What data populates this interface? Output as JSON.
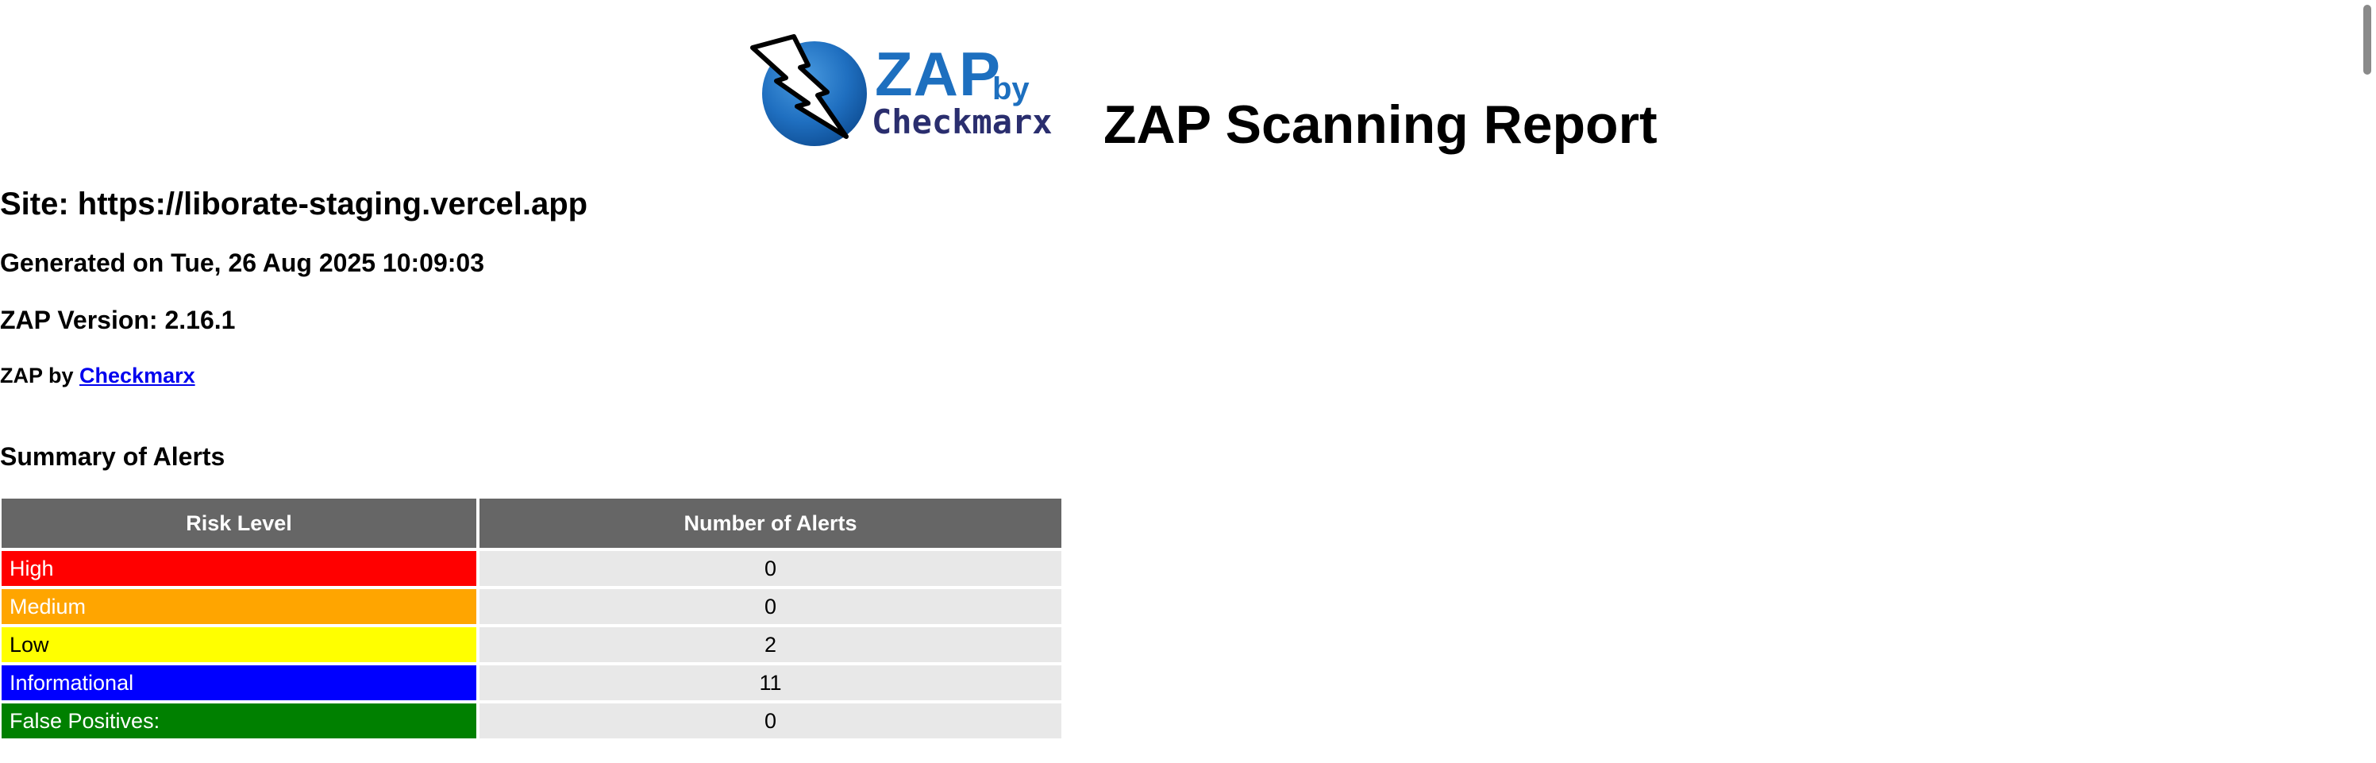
{
  "logo": {
    "icon": "lightning-bolt-icon",
    "word": "ZAP",
    "by": "by",
    "brand": "Checkmarx"
  },
  "report_title": "ZAP Scanning Report",
  "site_line": "Site: https://liborate-staging.vercel.app",
  "generated_line": "Generated on Tue, 26 Aug 2025 10:09:03",
  "version_line": "ZAP Version: 2.16.1",
  "byline": {
    "prefix": "ZAP by ",
    "link": "Checkmarx"
  },
  "summary_title": "Summary of Alerts",
  "table": {
    "headers": [
      "Risk Level",
      "Number of Alerts"
    ],
    "rows": [
      {
        "risk": "High",
        "count": "0",
        "color": "#ff0000"
      },
      {
        "risk": "Medium",
        "count": "0",
        "color": "#ffa500"
      },
      {
        "risk": "Low",
        "count": "2",
        "color": "#ffff00"
      },
      {
        "risk": "Informational",
        "count": "11",
        "color": "#0000ff"
      },
      {
        "risk": "False Positives:",
        "count": "0",
        "color": "#008000"
      }
    ]
  },
  "colors": {
    "header_bg": "#666666",
    "count_bg": "#e8e8e8",
    "logo_blue": "#1d6fbf",
    "logo_navy": "#2a2e6e",
    "link": "#0000ee"
  }
}
